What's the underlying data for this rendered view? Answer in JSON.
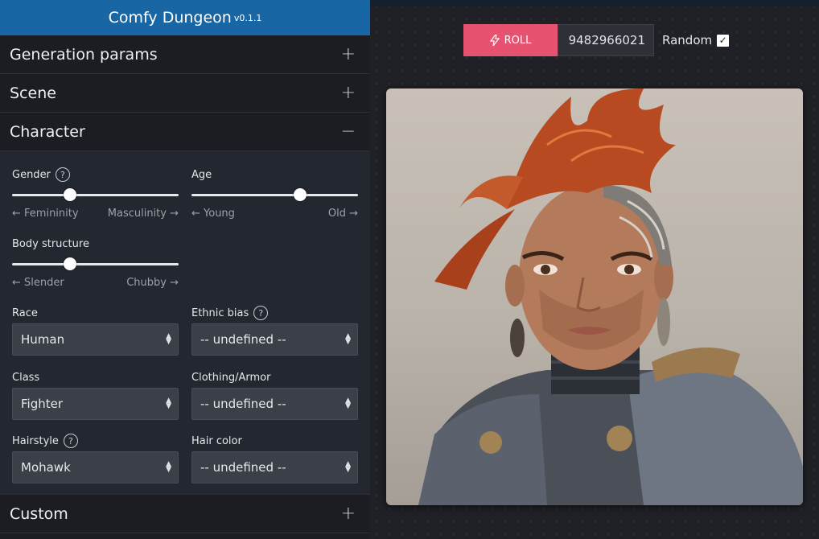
{
  "app": {
    "title": "Comfy Dungeon",
    "version": "v0.1.1"
  },
  "sections": {
    "generation": {
      "label": "Generation params",
      "toggle": "+"
    },
    "scene": {
      "label": "Scene",
      "toggle": "+"
    },
    "character": {
      "label": "Character",
      "toggle": "−"
    },
    "custom": {
      "label": "Custom",
      "toggle": "+"
    }
  },
  "character": {
    "gender": {
      "label": "Gender",
      "help": "?",
      "value": 0.35,
      "left": "← Femininity",
      "right": "Masculinity →"
    },
    "age": {
      "label": "Age",
      "value": 0.65,
      "left": "← Young",
      "right": "Old →"
    },
    "body": {
      "label": "Body structure",
      "value": 0.35,
      "left": "← Slender",
      "right": "Chubby →"
    },
    "race": {
      "label": "Race",
      "value": "Human"
    },
    "ethnic": {
      "label": "Ethnic bias",
      "help": "?",
      "value": "-- undefined --"
    },
    "class": {
      "label": "Class",
      "value": "Fighter"
    },
    "clothing": {
      "label": "Clothing/Armor",
      "value": "-- undefined --"
    },
    "hairstyle": {
      "label": "Hairstyle",
      "help": "?",
      "value": "Mohawk"
    },
    "haircolor": {
      "label": "Hair color",
      "value": "-- undefined --"
    }
  },
  "roll": {
    "label": "ROLL",
    "icon": "lightning-icon",
    "seed": "9482966021",
    "random_label": "Random",
    "random_checked": "✓"
  },
  "colors": {
    "header": "#1866a4",
    "roll": "#e85271"
  }
}
